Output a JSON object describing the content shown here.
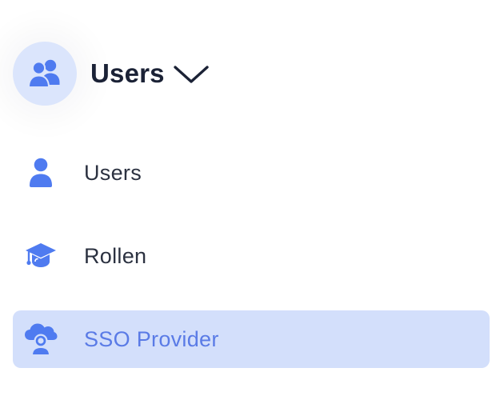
{
  "header": {
    "title": "Users",
    "icon": "users-group-icon",
    "chevron_icon": "chevron-down-icon"
  },
  "menu": {
    "items": [
      {
        "label": "Users",
        "icon": "user-icon",
        "active": false
      },
      {
        "label": "Rollen",
        "icon": "graduation-cap-icon",
        "active": false
      },
      {
        "label": "SSO Provider",
        "icon": "cloud-user-icon",
        "active": true
      }
    ]
  },
  "colors": {
    "accent": "#4f7bf0",
    "active_background": "#d3dffb",
    "avatar_background": "#dbe5fc",
    "title_text": "#1b2236",
    "body_text": "#2b3140",
    "active_text": "#5a7be6"
  }
}
